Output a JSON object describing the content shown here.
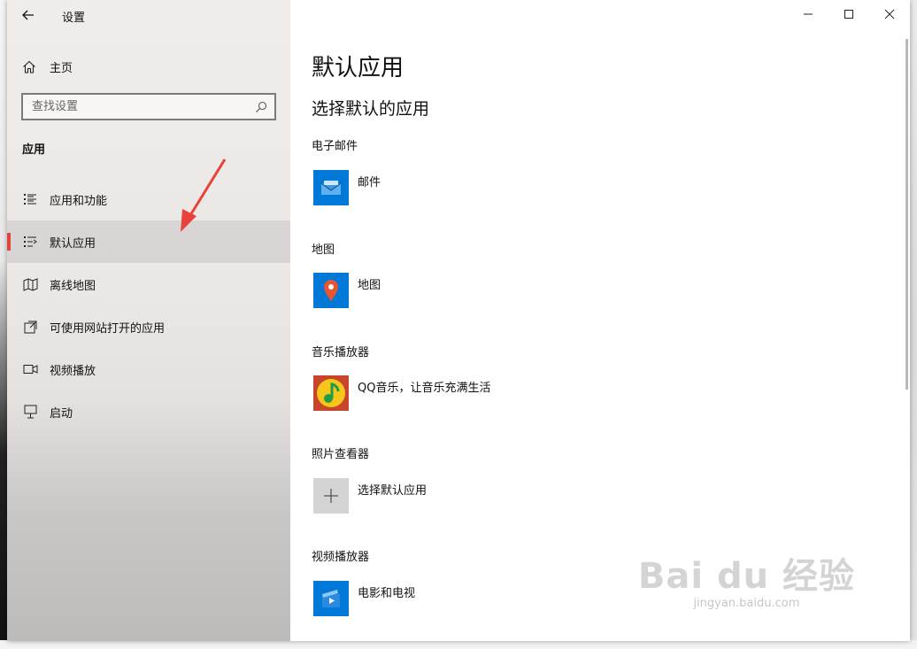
{
  "window": {
    "title": "设置"
  },
  "sidebar": {
    "home_label": "主页",
    "search_placeholder": "查找设置",
    "section_header": "应用",
    "items": [
      {
        "label": "应用和功能",
        "icon": "list-icon",
        "selected": false
      },
      {
        "label": "默认应用",
        "icon": "default-apps-icon",
        "selected": true
      },
      {
        "label": "离线地图",
        "icon": "map-icon",
        "selected": false
      },
      {
        "label": "可使用网站打开的应用",
        "icon": "open-in-icon",
        "selected": false
      },
      {
        "label": "视频播放",
        "icon": "video-icon",
        "selected": false
      },
      {
        "label": "启动",
        "icon": "startup-icon",
        "selected": false
      }
    ]
  },
  "main": {
    "page_title": "默认应用",
    "subtitle": "选择默认的应用",
    "categories": [
      {
        "label": "电子邮件",
        "app": "邮件",
        "icon": "mail-icon",
        "color": "#0078d7"
      },
      {
        "label": "地图",
        "app": "地图",
        "icon": "maps-pin-icon",
        "color": "#0078d7"
      },
      {
        "label": "音乐播放器",
        "app": "QQ音乐，让音乐充满生活",
        "icon": "qq-music-icon",
        "color": "#c8452b"
      },
      {
        "label": "照片查看器",
        "app": "选择默认应用",
        "icon": "plus-icon",
        "color": "#d4d4d4"
      },
      {
        "label": "视频播放器",
        "app": "电影和电视",
        "icon": "movies-tv-icon",
        "color": "#0078d7"
      }
    ]
  },
  "watermark": {
    "main": "Bai du 经验",
    "sub": "jingyan.baidu.com"
  },
  "colors": {
    "accent": "#0078d7",
    "selection_bar": "#e0453c",
    "annotation_arrow": "#e8423a"
  }
}
